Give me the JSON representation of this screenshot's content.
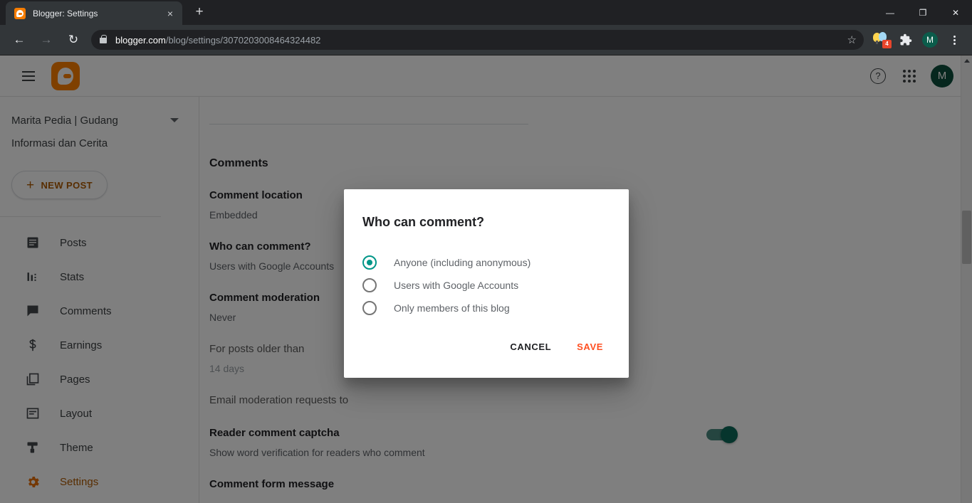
{
  "browser": {
    "tab": {
      "title": "Blogger: Settings",
      "favicon": "blogger-favicon",
      "close": "×"
    },
    "new_tab": "+",
    "window_controls": {
      "minimize": "—",
      "maximize": "❐",
      "close": "✕"
    },
    "nav": {
      "back": "←",
      "forward": "→",
      "reload": "↻"
    },
    "omnibox": {
      "host": "blogger.com",
      "path": "/blog/settings/3070203008464324482",
      "lock": "lock-icon",
      "star": "☆"
    },
    "extensions": {
      "badge_count": "4",
      "puzzle": "🧩"
    },
    "profile_initial": "M",
    "menu": "kebab-menu"
  },
  "header": {
    "menu_label": "hamburger-menu",
    "logo_label": "blogger-logo",
    "help": "?",
    "apps": "apps-grid",
    "avatar_initial": "M"
  },
  "sidebar": {
    "blog_title": "Marita Pedia | Gudang Informasi dan Cerita",
    "new_post": {
      "plus": "+",
      "label": "NEW POST"
    },
    "items": [
      {
        "label": "Posts",
        "icon": "posts-icon",
        "active": false
      },
      {
        "label": "Stats",
        "icon": "stats-icon",
        "active": false
      },
      {
        "label": "Comments",
        "icon": "comments-icon",
        "active": false
      },
      {
        "label": "Earnings",
        "icon": "earnings-icon",
        "active": false
      },
      {
        "label": "Pages",
        "icon": "pages-icon",
        "active": false
      },
      {
        "label": "Layout",
        "icon": "layout-icon",
        "active": false
      },
      {
        "label": "Theme",
        "icon": "theme-icon",
        "active": false
      },
      {
        "label": "Settings",
        "icon": "settings-icon",
        "active": true
      }
    ]
  },
  "content": {
    "section_title": "Comments",
    "settings": [
      {
        "label": "Comment location",
        "value": "Embedded"
      },
      {
        "label": "Who can comment?",
        "value": "Users with Google Accounts"
      },
      {
        "label": "Comment moderation",
        "value": "Never"
      },
      {
        "label": "For posts older than",
        "value": "14 days"
      },
      {
        "label": "Email moderation requests to",
        "value": ""
      },
      {
        "label": "Reader comment captcha",
        "value": "Show word verification for readers who comment"
      },
      {
        "label": "Comment form message",
        "value": ""
      }
    ],
    "captcha_toggle_on": true
  },
  "dialog": {
    "title": "Who can comment?",
    "options": [
      {
        "label": "Anyone (including anonymous)",
        "selected": true
      },
      {
        "label": "Users with Google Accounts",
        "selected": false
      },
      {
        "label": "Only members of this blog",
        "selected": false
      }
    ],
    "cancel": "CANCEL",
    "save": "SAVE"
  },
  "colors": {
    "accent_orange": "#b05a00",
    "save_orange": "#ff4f21",
    "radio_teal": "#009688",
    "toggle_teal": "#0d6b5a",
    "avatar_green": "#0d4f3c"
  }
}
